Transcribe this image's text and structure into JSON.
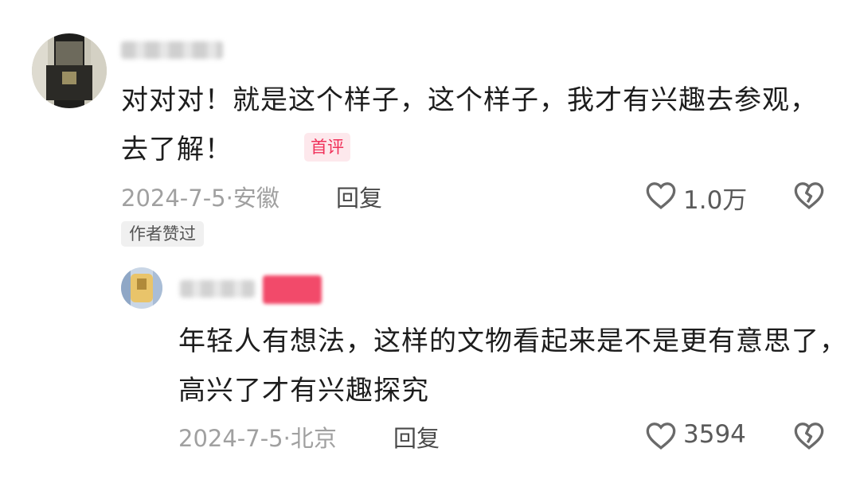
{
  "comment": {
    "text": "对对对！就是这个样子，这个样子，我才有兴趣去参观，去了解！",
    "first_comment_tag": "首评",
    "date_location": "2024-7-5·安徽",
    "reply_label": "回复",
    "like_count": "1.0万",
    "author_liked_badge": "作者赞过",
    "icons": [
      "heart-outline-icon",
      "broken-heart-icon"
    ]
  },
  "reply": {
    "text": "年轻人有想法，这样的文物看起来是不是更有意思了，高兴了才有兴趣探究",
    "date_location": "2024-7-5·北京",
    "reply_label": "回复",
    "like_count": "3594",
    "icons": [
      "heart-outline-icon",
      "broken-heart-icon"
    ]
  },
  "colors": {
    "tag_red": "#f0315a",
    "tag_bg": "#fde8ec",
    "meta_gray": "#a0a0a0"
  }
}
